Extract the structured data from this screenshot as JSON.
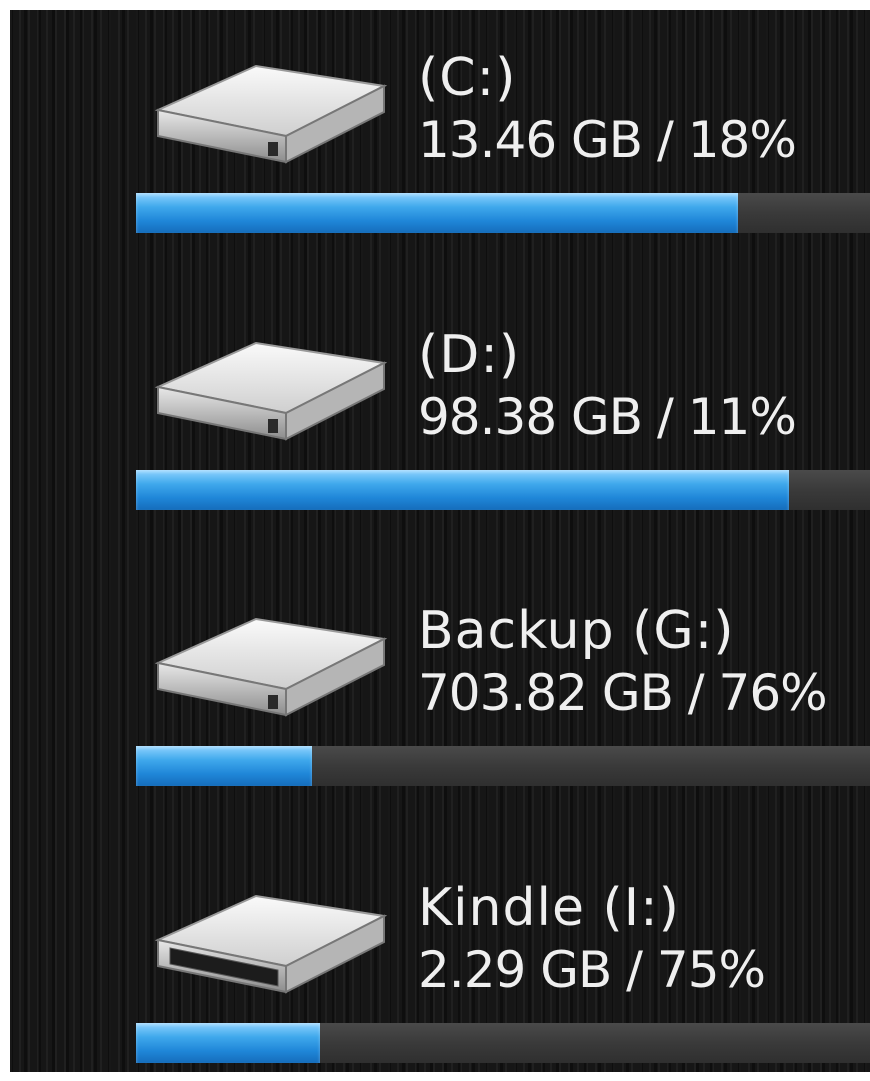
{
  "drives": [
    {
      "name": "(C:)",
      "usage": "13.46 GB / 18%",
      "bar_fill_fraction": 0.82,
      "icon": "hard-drive-icon"
    },
    {
      "name": "(D:)",
      "usage": "98.38 GB / 11%",
      "bar_fill_fraction": 0.89,
      "icon": "hard-drive-icon"
    },
    {
      "name": "Backup (G:)",
      "usage": "703.82 GB / 76%",
      "bar_fill_fraction": 0.24,
      "icon": "hard-drive-icon"
    },
    {
      "name": "Kindle (I:)",
      "usage": "2.29 GB / 75%",
      "bar_fill_fraction": 0.25,
      "icon": "removable-drive-icon"
    }
  ],
  "colors": {
    "bar_fill": "#2a93e0",
    "bar_track": "#3c3c3c",
    "text": "#efefef",
    "background": "#161616"
  }
}
